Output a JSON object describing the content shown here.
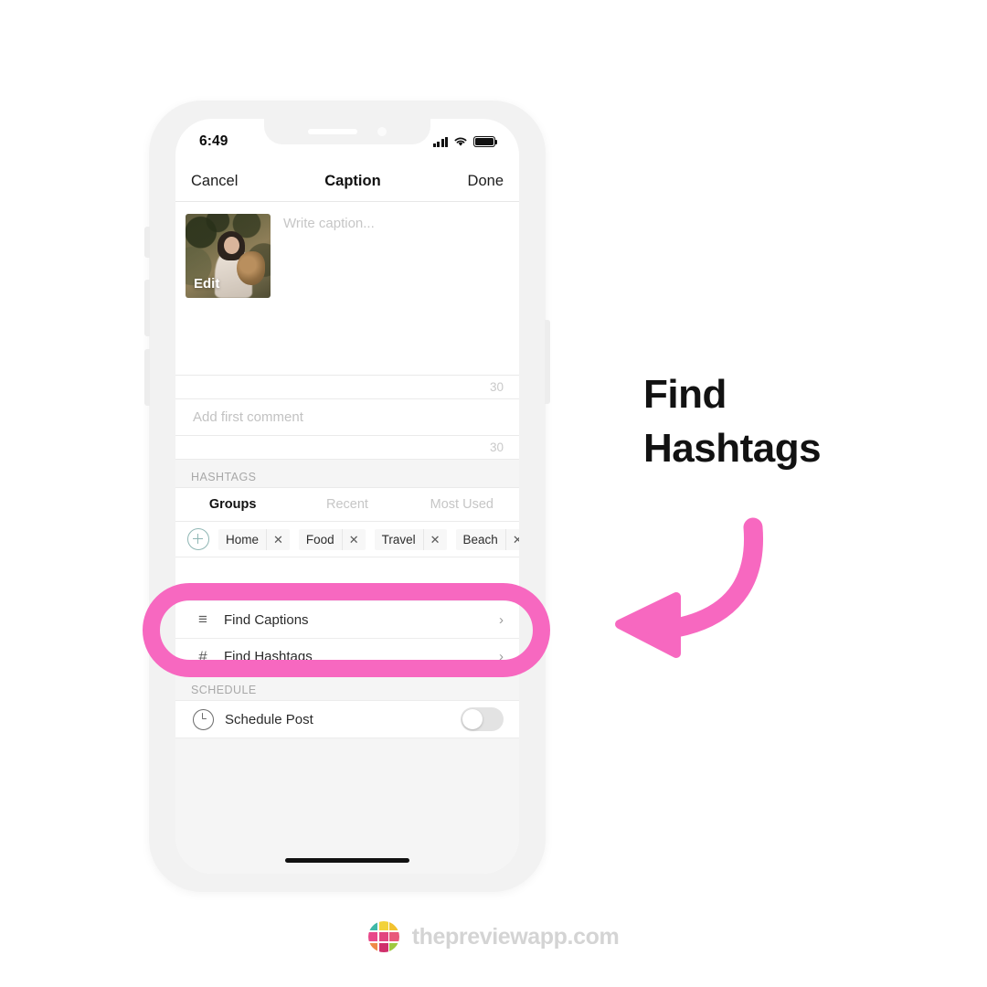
{
  "status_bar": {
    "time": "6:49",
    "signal_icon": "cellular-bars-icon",
    "wifi_icon": "wifi-icon",
    "battery_icon": "battery-full-icon"
  },
  "nav_bar": {
    "cancel_label": "Cancel",
    "title": "Caption",
    "done_label": "Done"
  },
  "caption": {
    "thumbnail_edit_label": "Edit",
    "placeholder": "Write caption...",
    "counter": "30"
  },
  "comment": {
    "placeholder": "Add first comment",
    "counter": "30"
  },
  "hashtags": {
    "section_label": "HASHTAGS",
    "tabs": [
      {
        "label": "Groups",
        "active": true
      },
      {
        "label": "Recent",
        "active": false
      },
      {
        "label": "Most Used",
        "active": false
      }
    ],
    "add_group_icon": "plus-circle-icon",
    "chips": [
      {
        "label": "Home",
        "remove_icon": "close-icon"
      },
      {
        "label": "Food",
        "remove_icon": "close-icon"
      },
      {
        "label": "Travel",
        "remove_icon": "close-icon"
      },
      {
        "label": "Beach",
        "remove_icon": "close-icon"
      }
    ]
  },
  "tools": [
    {
      "icon": "list-lines-icon",
      "glyph": "≡",
      "label": "Find Captions",
      "chevron": "›"
    },
    {
      "icon": "hash-icon",
      "glyph": "#",
      "label": "Find Hashtags",
      "chevron": "›"
    }
  ],
  "schedule": {
    "section_label": "SCHEDULE",
    "clock_icon": "clock-icon",
    "label": "Schedule Post",
    "toggle_state": "off"
  },
  "callout": {
    "headline_line1": "Find",
    "headline_line2": "Hashtags",
    "arrow_icon": "curved-arrow-left-icon",
    "highlight_color": "#f768c0"
  },
  "footer": {
    "logo_icon": "preview-app-logo-icon",
    "text": "thepreviewapp.com",
    "logo_colors": [
      "#3fb9a8",
      "#f2d23a",
      "#f2c230",
      "#e8488a",
      "#e2457f",
      "#e8597a",
      "#ef8a47",
      "#cf2f6b",
      "#9fc93f"
    ]
  }
}
